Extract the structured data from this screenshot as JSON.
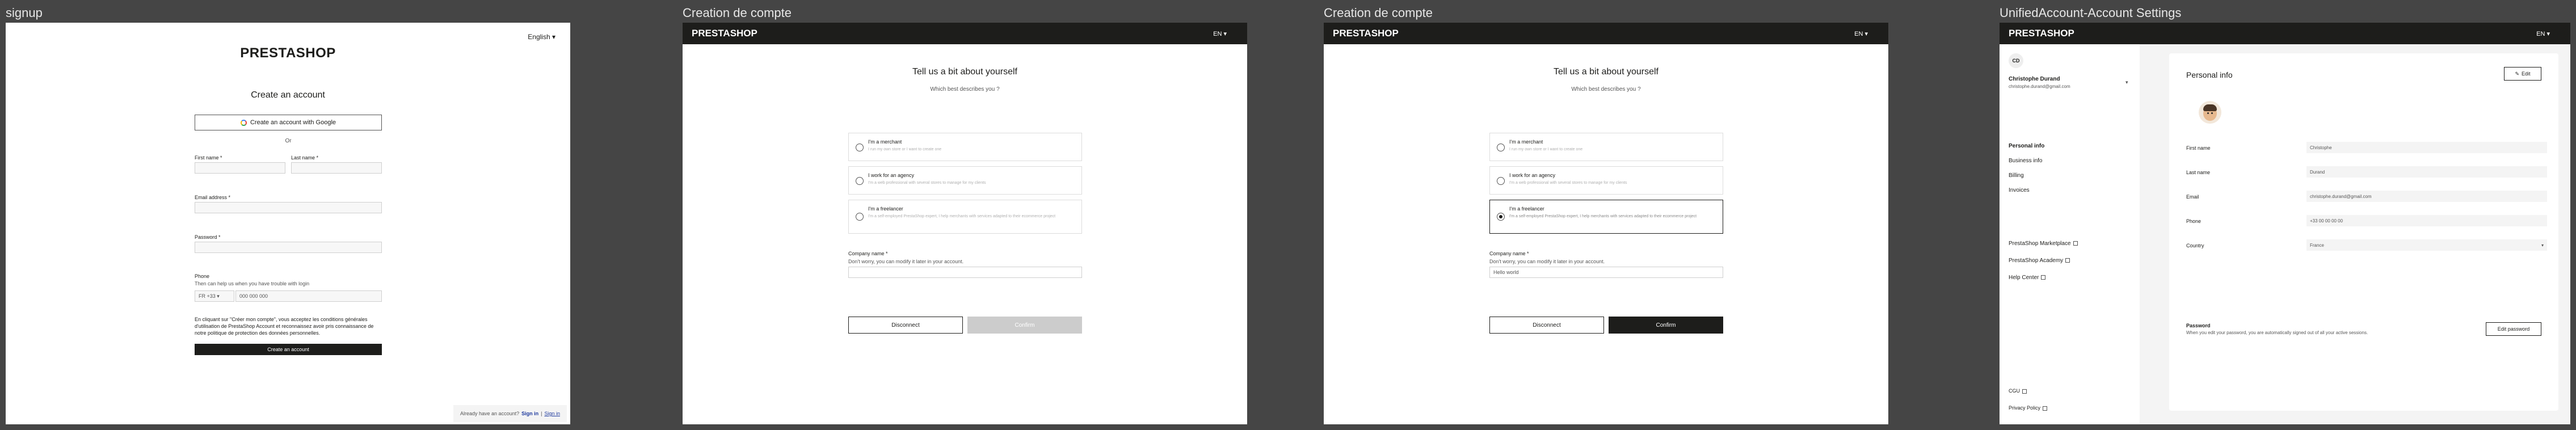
{
  "frame_labels": [
    "signup",
    "Creation de compte",
    "Creation de compte",
    "UnifiedAccount-Account Settings"
  ],
  "signup": {
    "language": "English ▾",
    "brand": "PRESTASHOP",
    "title": "Create an account",
    "google_button": "Create an account with Google",
    "or_text": "Or",
    "first_name_label": "First name *",
    "last_name_label": "Last name *",
    "email_label": "Email address *",
    "password_label": "Password *",
    "phone_label": "Phone",
    "phone_hint": "Then can help us when you have trouble with login",
    "phone_prefix": "FR +33 ▾",
    "phone_placeholder": "000 000 000",
    "consent_text": "En cliquant sur \"Créer mon compte\", vous acceptez les conditions générales d'utilisation de PrestaShop Account et reconnaissez avoir pris connaissance de notre politique de protection des données personnelles.",
    "create_button": "Create an account",
    "footer_question": "Already have an account?",
    "footer_sign_in": "Sign in",
    "footer_sign_up": "Sign in"
  },
  "creation": {
    "brand": "PRESTASHOP",
    "language": "EN ▾",
    "title": "Tell us a bit about yourself",
    "subtitle": "Which best describes you ?",
    "options": [
      {
        "title": "I'm a merchant",
        "desc": "I run my own store or I want to create one"
      },
      {
        "title": "I work for an agency",
        "desc": "I'm a web professional with several stores to manage for my clients"
      },
      {
        "title": "I'm a freelancer",
        "desc": "I'm a self-employed PrestaShop expert, I help merchants with services adapted to their ecommerce project"
      }
    ],
    "company_label": "Company name *",
    "company_hint": "Don't worry, you can modify it later in your account.",
    "company_value_filled": "Hello world",
    "disconnect_button": "Disconnect",
    "confirm_button": "Confirm"
  },
  "account": {
    "brand": "PRESTASHOP",
    "language": "EN ▾",
    "initials": "CD",
    "user_name": "Christophe Durand",
    "user_email": "christophe.durand@gmail.com",
    "nav": [
      "Personal info",
      "Business info",
      "Billing",
      "Invoices"
    ],
    "external_links": [
      "PrestaShop Marketplace",
      "PrestaShop Academy",
      "Help Center"
    ],
    "legal_links": [
      "CGU",
      "Privacy Policy"
    ],
    "card_title": "Personal info",
    "edit_button": "Edit",
    "fields": [
      {
        "label": "First name",
        "value": "Christophe"
      },
      {
        "label": "Last name",
        "value": "Durand"
      },
      {
        "label": "Email",
        "value": "christophe.durand@gmail.com"
      },
      {
        "label": "Phone",
        "value": "+33 00 00 00 00"
      },
      {
        "label": "Country",
        "value": "France"
      }
    ],
    "password_label": "Password",
    "password_hint": "When you edit your password, you are automatically signed out of all your active sessions.",
    "password_button": "Edit password"
  }
}
